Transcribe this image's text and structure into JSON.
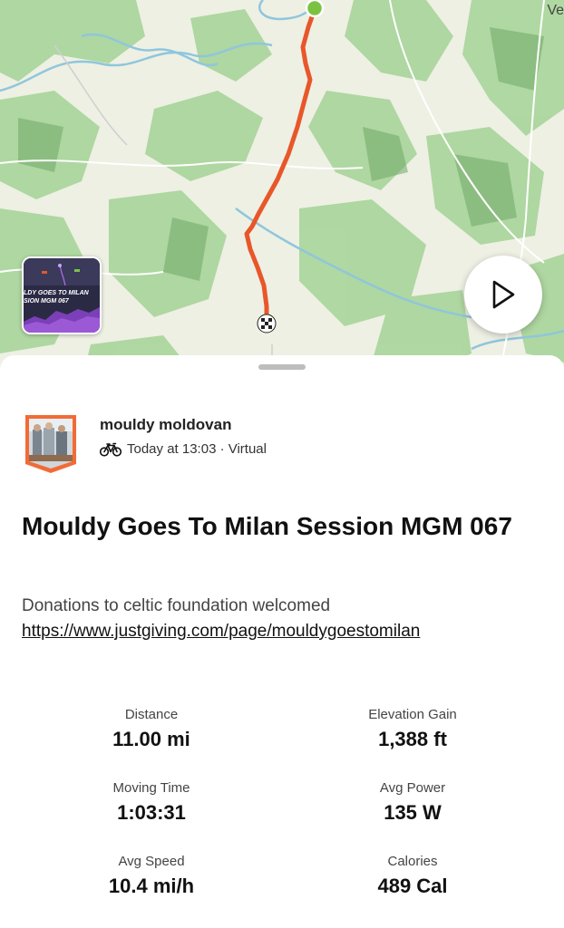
{
  "map": {
    "place_label": "Ve",
    "route_color": "#e8572a",
    "start_color": "#7cc242"
  },
  "thumbnail": {
    "line1": "LDY GOES TO MILAN",
    "line2": "SION MGM 067"
  },
  "activity": {
    "athlete_name": "mouldy moldovan",
    "timestamp": "Today at 13:03 · Virtual",
    "sport_icon": "bicycle-icon",
    "title": "Mouldy Goes To Milan Session MGM 067",
    "description": "Donations to celtic foundation welcomed",
    "link": "https://www.justgiving.com/page/mouldygoestomilan"
  },
  "stats": [
    {
      "label": "Distance",
      "value": "11.00 mi"
    },
    {
      "label": "Elevation Gain",
      "value": "1,388 ft"
    },
    {
      "label": "Moving Time",
      "value": "1:03:31"
    },
    {
      "label": "Avg Power",
      "value": "135 W"
    },
    {
      "label": "Avg Speed",
      "value": "10.4 mi/h"
    },
    {
      "label": "Calories",
      "value": "489 Cal"
    }
  ]
}
